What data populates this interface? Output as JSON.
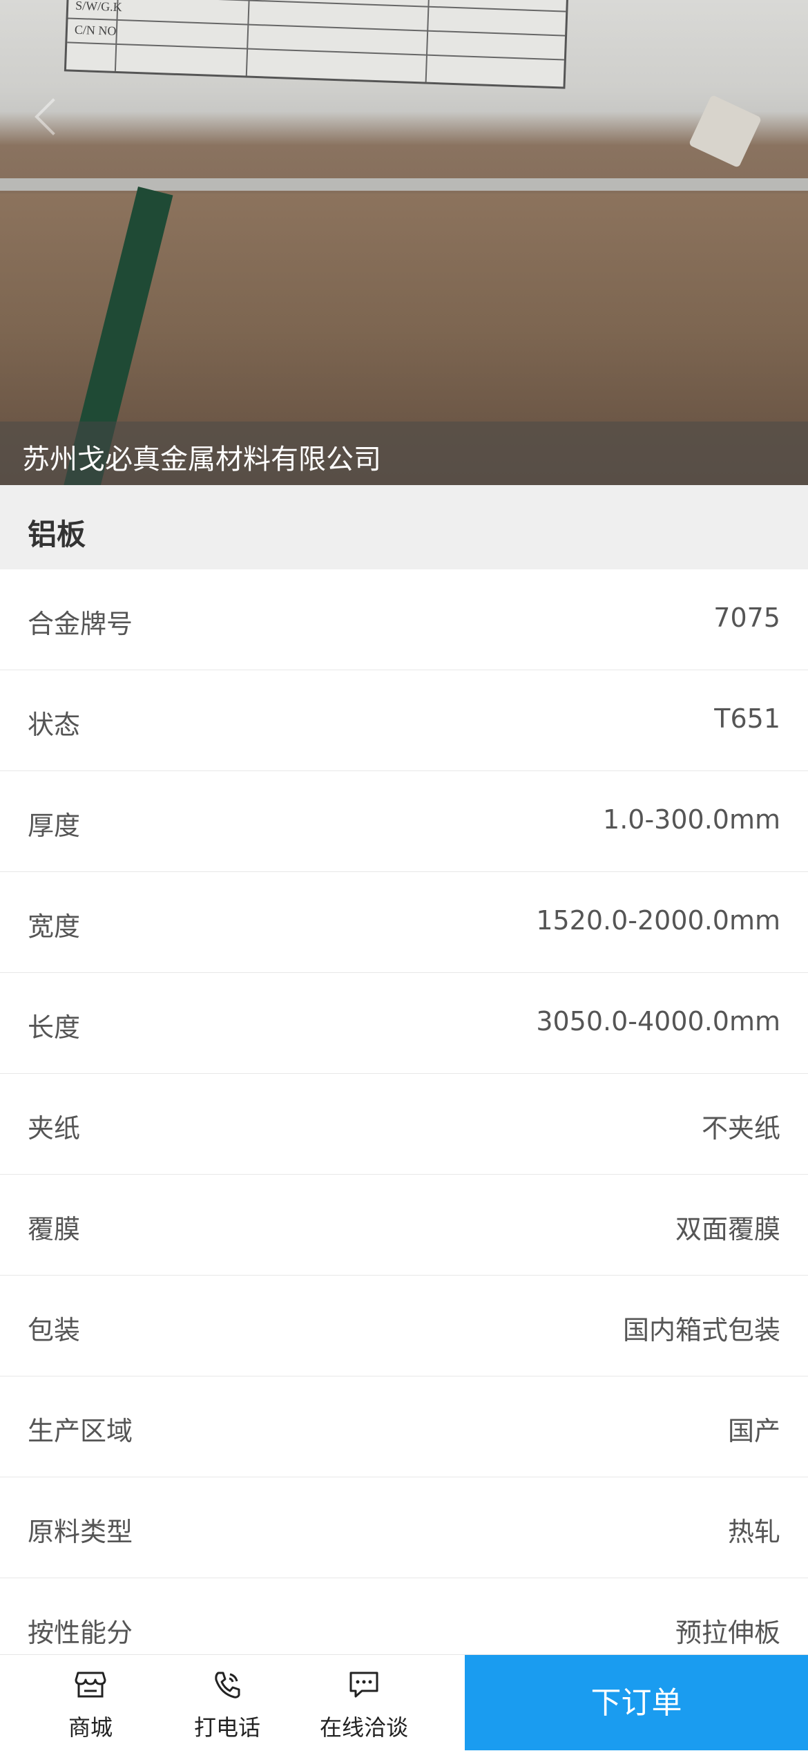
{
  "hero": {
    "company_name": "苏州戈必真金属材料有限公司",
    "label_texts": [
      "S/W/G.K",
      "C/N NO"
    ]
  },
  "product": {
    "title": "铝板"
  },
  "specs": [
    {
      "label": "合金牌号",
      "value": "7075"
    },
    {
      "label": "状态",
      "value": "T651"
    },
    {
      "label": "厚度",
      "value": "1.0-300.0mm"
    },
    {
      "label": "宽度",
      "value": "1520.0-2000.0mm"
    },
    {
      "label": "长度",
      "value": "3050.0-4000.0mm"
    },
    {
      "label": "夹纸",
      "value": "不夹纸"
    },
    {
      "label": "覆膜",
      "value": "双面覆膜"
    },
    {
      "label": "包装",
      "value": "国内箱式包装"
    },
    {
      "label": "生产区域",
      "value": "国产"
    },
    {
      "label": "原料类型",
      "value": "热轧"
    },
    {
      "label": "按性能分",
      "value": "预拉伸板"
    }
  ],
  "bottom_bar": {
    "tabs": [
      {
        "label": "商城",
        "icon": "store-icon"
      },
      {
        "label": "打电话",
        "icon": "phone-icon"
      },
      {
        "label": "在线洽谈",
        "icon": "chat-icon"
      }
    ],
    "order_button": "下订单",
    "accent_color": "#1a9cf0"
  }
}
